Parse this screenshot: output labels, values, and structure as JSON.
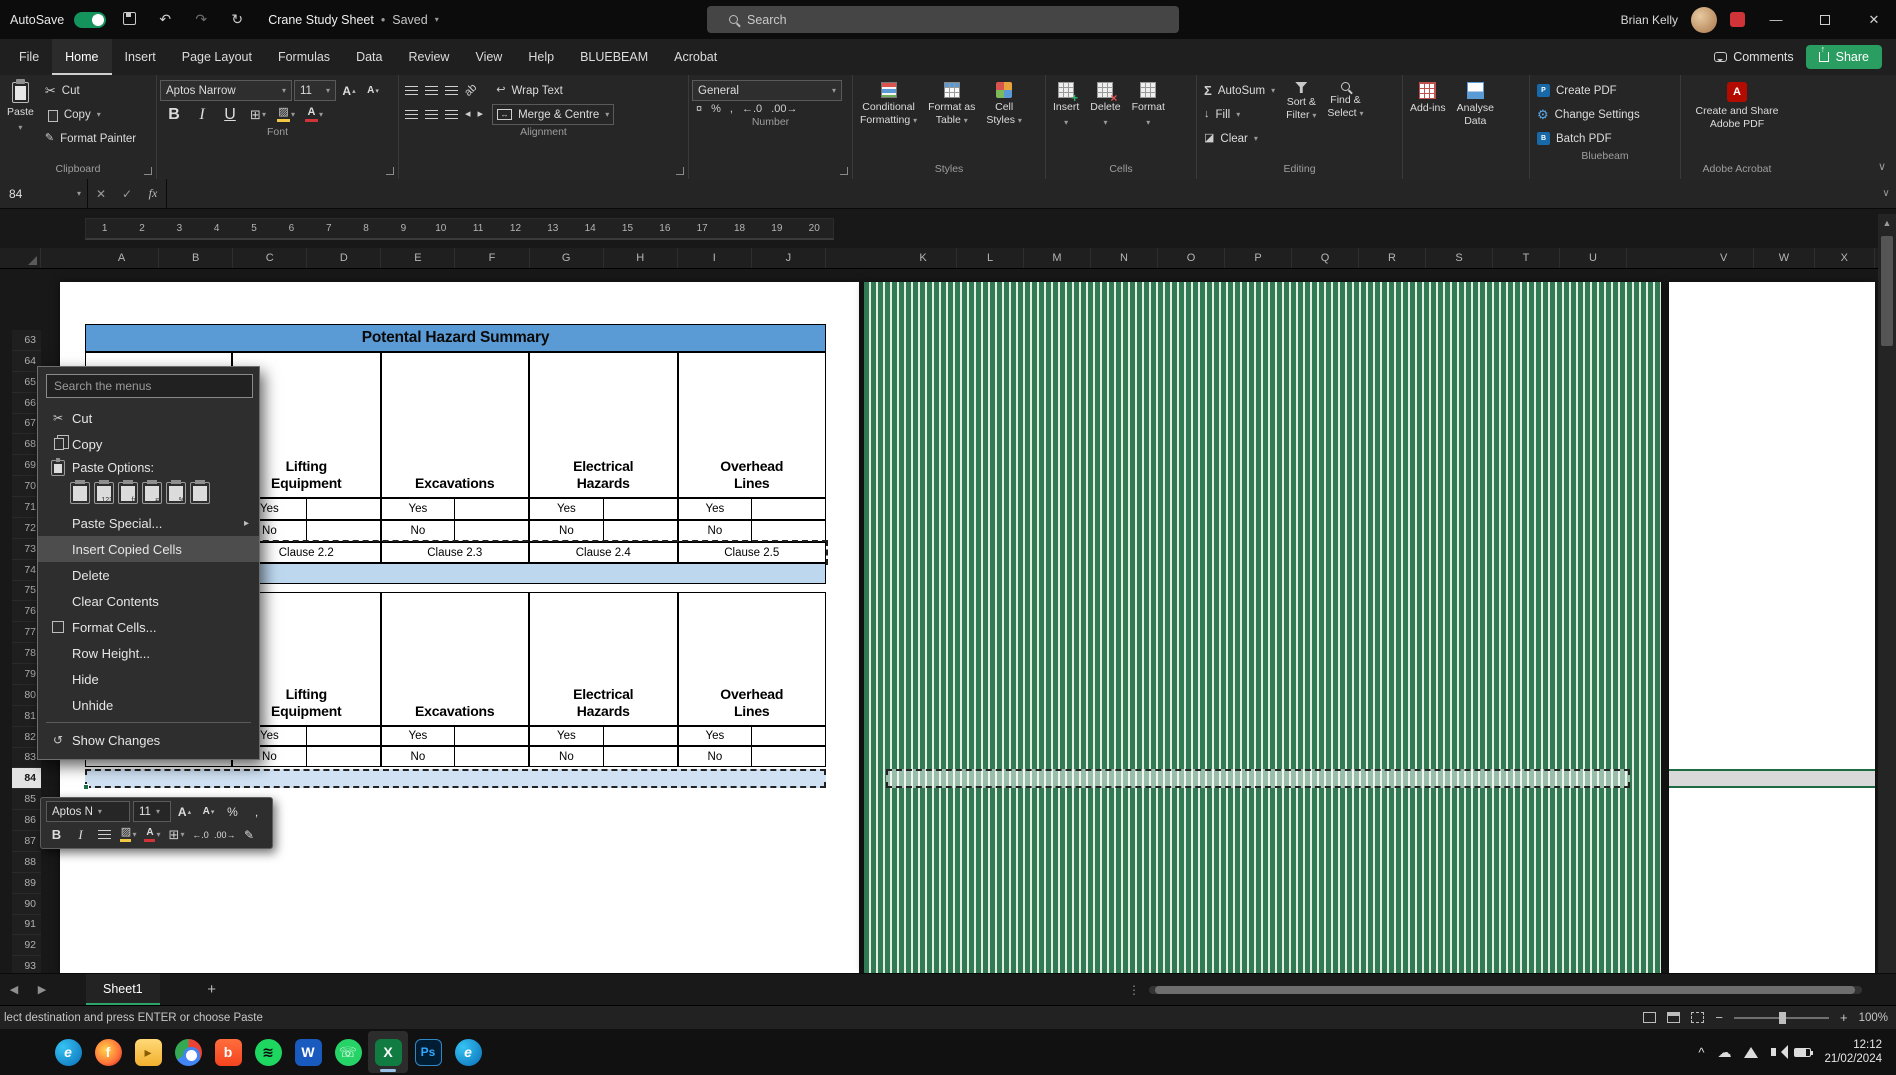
{
  "titlebar": {
    "autosave_label": "AutoSave",
    "doc_title": "Crane Study Sheet",
    "doc_sep": "•",
    "doc_status": "Saved",
    "search_placeholder": "Search",
    "user_name": "Brian Kelly"
  },
  "ribbon_tabs": [
    {
      "label": "File"
    },
    {
      "label": "Home",
      "active": true
    },
    {
      "label": "Insert"
    },
    {
      "label": "Page Layout"
    },
    {
      "label": "Formulas"
    },
    {
      "label": "Data"
    },
    {
      "label": "Review"
    },
    {
      "label": "View"
    },
    {
      "label": "Help"
    },
    {
      "label": "BLUEBEAM"
    },
    {
      "label": "Acrobat"
    }
  ],
  "tabs_right": {
    "comments": "Comments",
    "share": "Share"
  },
  "ribbon": {
    "paste": "Paste",
    "cut": "Cut",
    "copy": "Copy",
    "format_painter": "Format Painter",
    "clipboard_group": "Clipboard",
    "font_name": "Aptos Narrow",
    "font_size": "11",
    "font_group": "Font",
    "wrap_text": "Wrap Text",
    "merge_centre": "Merge & Centre",
    "alignment_group": "Alignment",
    "number_format": "General",
    "number_group": "Number",
    "cond1": "Conditional",
    "cond2": "Formatting",
    "fat1": "Format as",
    "fat2": "Table",
    "cs1": "Cell",
    "cs2": "Styles",
    "styles_group": "Styles",
    "insert": "Insert",
    "delete": "Delete",
    "format": "Format",
    "cells_group": "Cells",
    "autosum": "AutoSum",
    "fill": "Fill",
    "clear": "Clear",
    "sf1": "Sort &",
    "sf2": "Filter",
    "fs1": "Find &",
    "fs2": "Select",
    "editing_group": "Editing",
    "addins": "Add-ins",
    "analyse1": "Analyse",
    "analyse2": "Data",
    "create_pdf": "Create PDF",
    "change_settings": "Change Settings",
    "batch_pdf": "Batch PDF",
    "bluebeam_group": "Bluebeam",
    "adobe1": "Create and Share",
    "adobe2": "Adobe PDF",
    "adobe_group": "Adobe Acrobat"
  },
  "formula_bar": {
    "name_box": "84",
    "fx": "fx",
    "value": ""
  },
  "ruler_numbers": [
    "1",
    "2",
    "3",
    "4",
    "5",
    "6",
    "7",
    "8",
    "9",
    "10",
    "11",
    "12",
    "13",
    "14",
    "15",
    "16",
    "17",
    "18",
    "19",
    "20"
  ],
  "grid": {
    "cols_a": [
      "A",
      "B",
      "C",
      "D",
      "E",
      "F",
      "G",
      "H",
      "I",
      "J"
    ],
    "cols_b": [
      "K",
      "L",
      "M",
      "N",
      "O",
      "P",
      "Q",
      "R",
      "S",
      "T",
      "U"
    ],
    "cols_c": [
      "V",
      "W",
      "X"
    ],
    "rows": [
      "63",
      "64",
      "65",
      "66",
      "67",
      "68",
      "69",
      "70",
      "71",
      "72",
      "73",
      "74",
      "75",
      "76",
      "77",
      "78",
      "79",
      "80",
      "81",
      "82",
      "83",
      "84",
      "85",
      "86",
      "87",
      "88",
      "89",
      "90",
      "91",
      "92",
      "93"
    ],
    "selected_row": "84"
  },
  "sheet": {
    "title": "Potental Hazard Summary",
    "headers": [
      {
        "l1": "Lifting",
        "l2": "Equipment"
      },
      {
        "l1": "Excavations",
        "l2": ""
      },
      {
        "l1": "Electrical",
        "l2": "Hazards"
      },
      {
        "l1": "Overhead",
        "l2": "Lines"
      }
    ],
    "yes_row": [
      "Yes",
      "Yes",
      "Yes",
      "Yes"
    ],
    "no_row": [
      "No",
      "No",
      "No",
      "No"
    ],
    "clauses": [
      "Clause 2.2",
      "Clause 2.3",
      "Clause 2.4",
      "Clause 2.5"
    ]
  },
  "context_menu": {
    "search_placeholder": "Search the menus",
    "cut": "Cut",
    "copy": "Copy",
    "paste_options_label": "Paste Options:",
    "paste_options": [
      {
        "name": "paste-keep-source-formatting",
        "mark": ""
      },
      {
        "name": "paste-values",
        "mark": "123"
      },
      {
        "name": "paste-formulas",
        "mark": "fx"
      },
      {
        "name": "paste-transpose",
        "mark": "⇄"
      },
      {
        "name": "paste-formatting",
        "mark": "%"
      },
      {
        "name": "paste-link",
        "mark": ""
      }
    ],
    "paste_special": "Paste Special...",
    "insert_copied_cells": "Insert Copied Cells",
    "delete": "Delete",
    "clear_contents": "Clear Contents",
    "format_cells": "Format Cells...",
    "row_height": "Row Height...",
    "hide": "Hide",
    "unhide": "Unhide",
    "show_changes": "Show Changes"
  },
  "mini_toolbar": {
    "font": "Aptos N",
    "size": "11"
  },
  "sheet_tabs": {
    "active": "Sheet1"
  },
  "status_bar": {
    "message": "lect destination and press ENTER or choose Paste",
    "zoom": "100%"
  },
  "taskbar": {
    "items": [
      {
        "id": "start"
      },
      {
        "id": "edge",
        "glyph": "e"
      },
      {
        "id": "firefox",
        "glyph": "f"
      },
      {
        "id": "explorer",
        "glyph": "▸"
      },
      {
        "id": "chrome",
        "glyph": ""
      },
      {
        "id": "brave",
        "glyph": "b"
      },
      {
        "id": "spotify",
        "glyph": "≋"
      },
      {
        "id": "word",
        "glyph": "W"
      },
      {
        "id": "whatsapp",
        "glyph": "☏"
      },
      {
        "id": "excel",
        "glyph": "X",
        "active": true
      },
      {
        "id": "photoshop",
        "glyph": "Ps"
      },
      {
        "id": "edge2",
        "glyph": "e"
      }
    ],
    "time": "12:12",
    "date": "21/02/2024"
  }
}
